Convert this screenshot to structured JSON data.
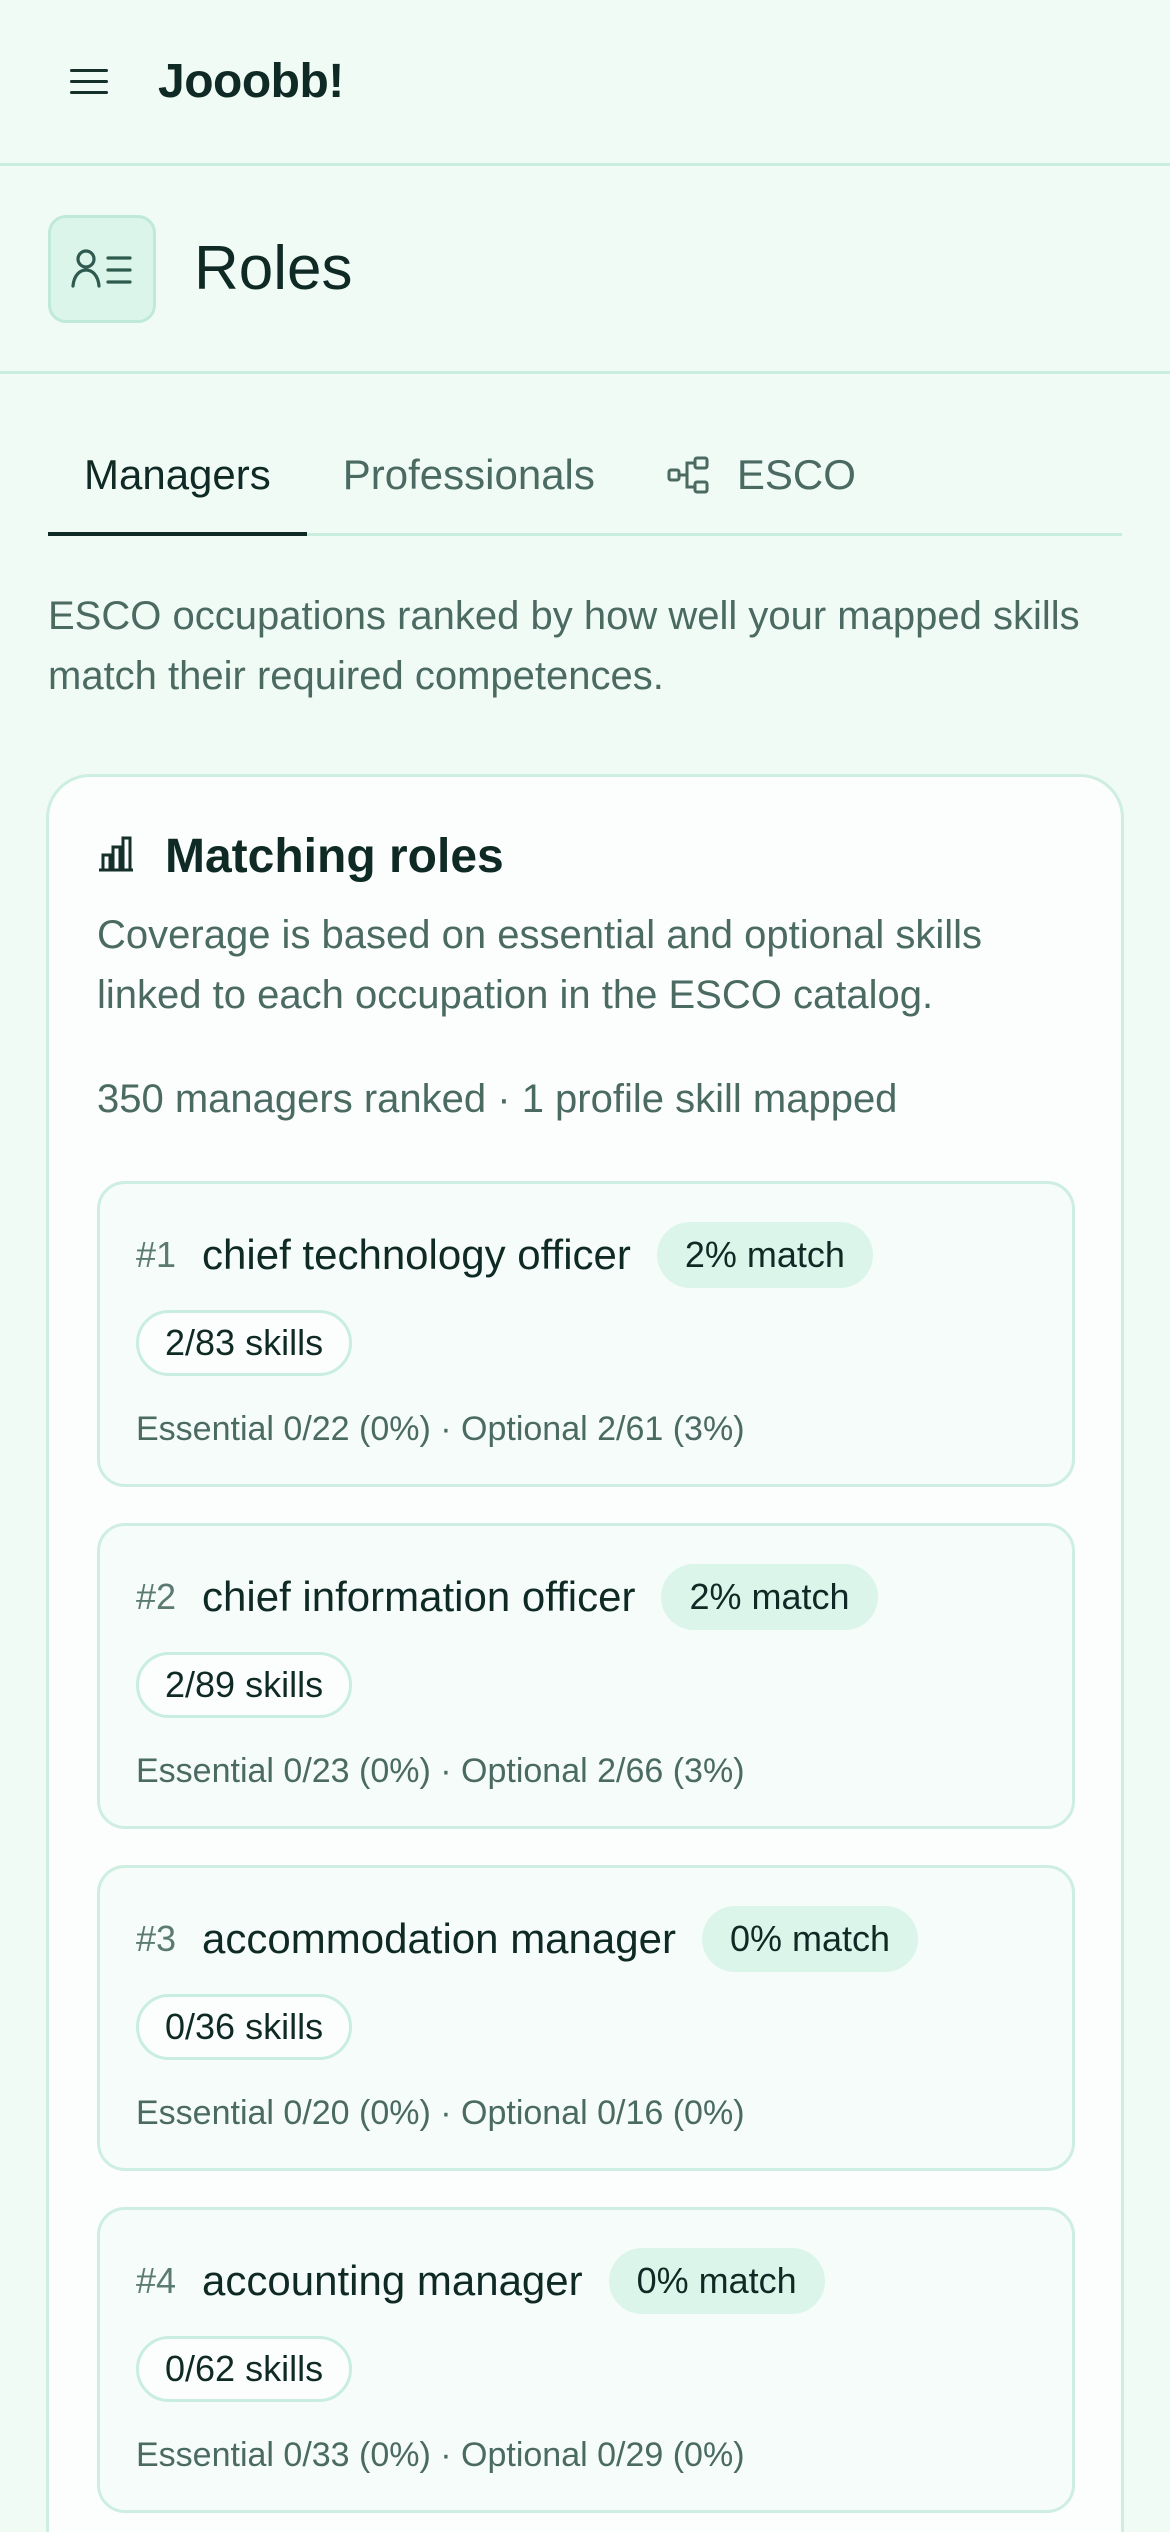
{
  "app": {
    "brand": "Jooobb!"
  },
  "icons": {
    "menu": "hamburger-icon",
    "roles": "user-list-icon",
    "esco": "network-icon",
    "chart": "bar-chart-icon"
  },
  "colors": {
    "background": "#f1fbf6",
    "accent_bg": "#dcf5ea",
    "border": "#c9eee0",
    "text": "#0f2a24",
    "muted": "#4a6a62"
  },
  "page": {
    "title": "Roles"
  },
  "tabs": [
    {
      "label": "Managers",
      "active": true
    },
    {
      "label": "Professionals",
      "active": false
    },
    {
      "label": "ESCO",
      "active": false
    }
  ],
  "intro": "ESCO occupations ranked by how well your mapped skills match their required competences.",
  "card": {
    "title": "Matching roles",
    "description": "Coverage is based on essential and optional skills linked to each occupation in the ESCO catalog.",
    "stats": "350 managers ranked · 1 profile skill mapped"
  },
  "roles": [
    {
      "rank": "#1",
      "name": "chief technology officer",
      "match": "2% match",
      "skills": "2/83 skills",
      "breakdown": "Essential 0/22 (0%) · Optional 2/61 (3%)"
    },
    {
      "rank": "#2",
      "name": "chief information officer",
      "match": "2% match",
      "skills": "2/89 skills",
      "breakdown": "Essential 0/23 (0%) · Optional 2/66 (3%)"
    },
    {
      "rank": "#3",
      "name": "accommodation manager",
      "match": "0% match",
      "skills": "0/36 skills",
      "breakdown": "Essential 0/20 (0%) · Optional 0/16 (0%)"
    },
    {
      "rank": "#4",
      "name": "accounting manager",
      "match": "0% match",
      "skills": "0/62 skills",
      "breakdown": "Essential 0/33 (0%) · Optional 0/29 (0%)"
    }
  ]
}
